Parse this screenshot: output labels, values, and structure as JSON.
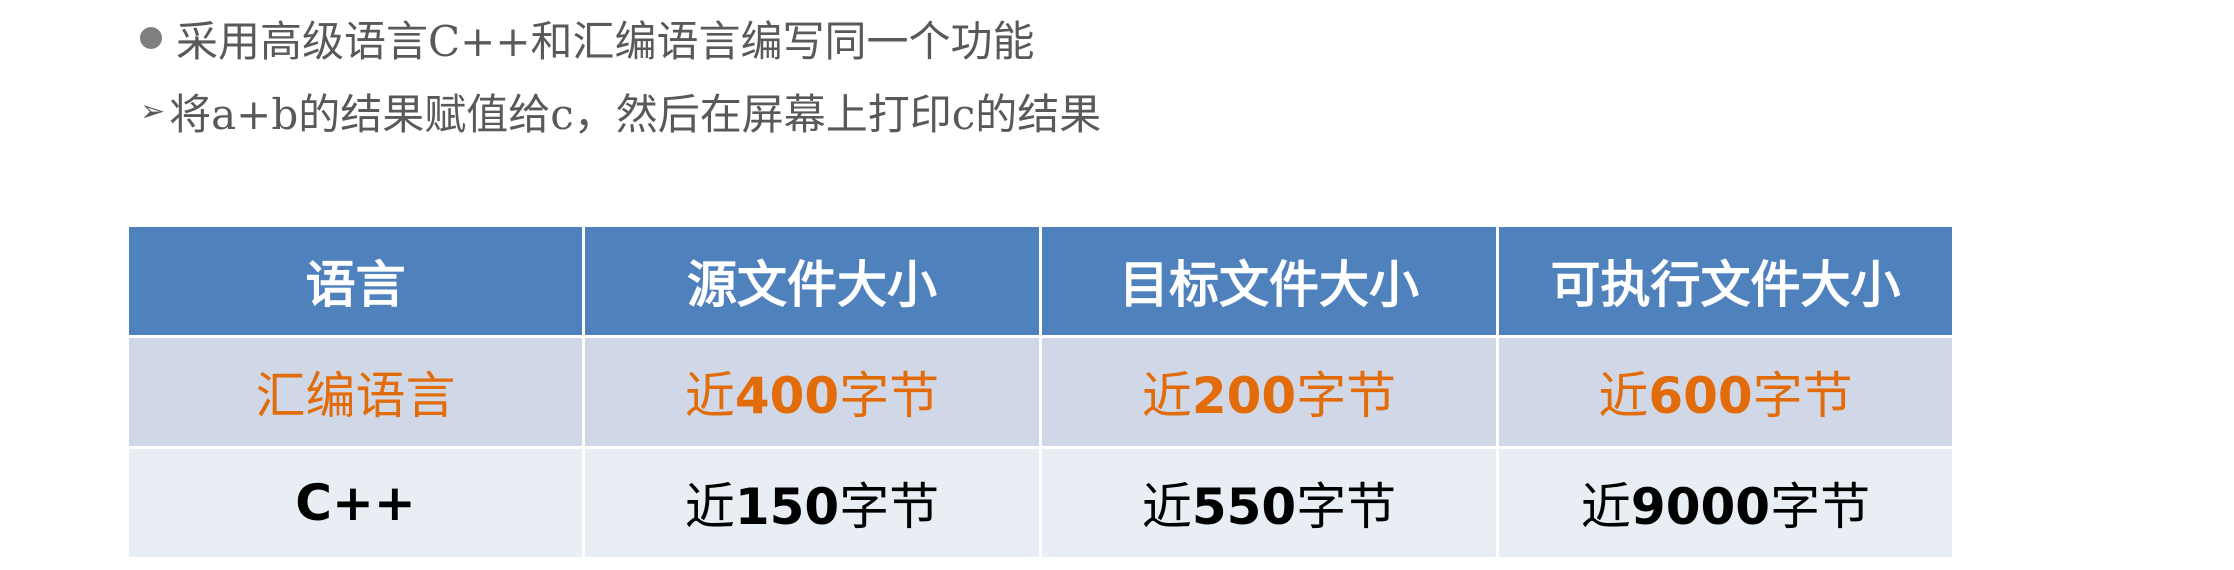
{
  "bullets": [
    {
      "marker": "dot",
      "text": "采用高级语言C++和汇编语言编写同一个功能"
    },
    {
      "marker": "arrow",
      "marker_glyph": "➢",
      "text": "将a+b的结果赋值给c，然后在屏幕上打印c的结果"
    }
  ],
  "table": {
    "headers": [
      "语言",
      "源文件大小",
      "目标文件大小",
      "可执行文件大小"
    ],
    "rows": [
      {
        "language": "汇编语言",
        "cells": [
          {
            "pre": "近",
            "num": "400",
            "post": "字节"
          },
          {
            "pre": "近",
            "num": "200",
            "post": "字节"
          },
          {
            "pre": "近",
            "num": "600",
            "post": "字节"
          }
        ]
      },
      {
        "language": "C++",
        "cells": [
          {
            "pre": "近",
            "num": "150",
            "post": "字节"
          },
          {
            "pre": "近",
            "num": "550",
            "post": "字节"
          },
          {
            "pre": "近",
            "num": "9000",
            "post": "字节"
          }
        ]
      }
    ]
  },
  "colors": {
    "header_bg": "#4f81bd",
    "row1_bg": "#d0d8e8",
    "row2_bg": "#e9edf4",
    "highlight_text": "#e36c0a",
    "bullet_text": "#595959"
  }
}
